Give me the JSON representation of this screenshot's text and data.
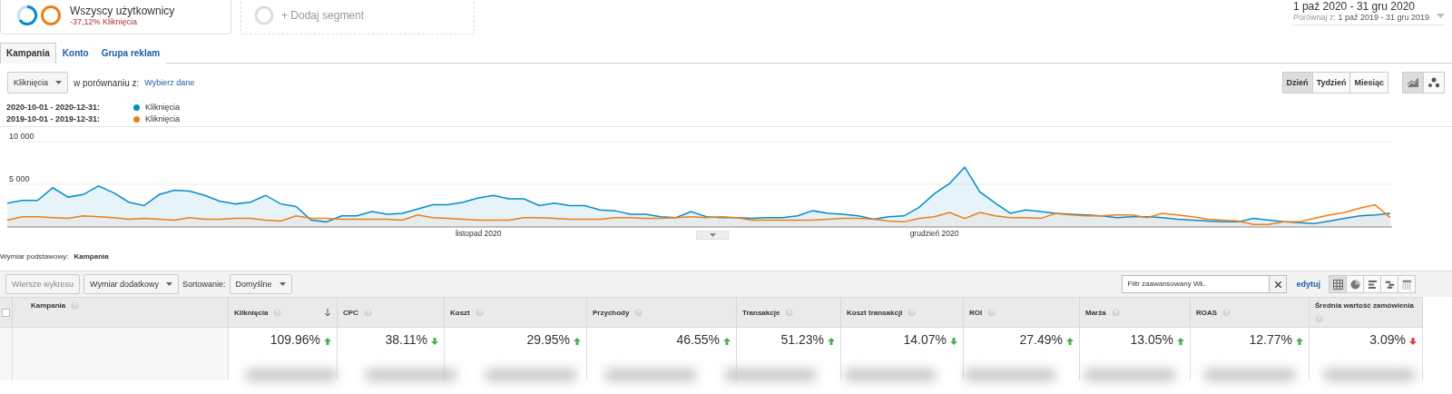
{
  "segments": [
    {
      "name": "Wszyscy użytkownicy",
      "detail": "-37,12% Kliknięcia"
    },
    {
      "name": "+ Dodaj segment",
      "kind": "add"
    }
  ],
  "date_range": {
    "main": "1 paź 2020 - 31 gru 2020",
    "compare_label": "Porównaj z:",
    "compare": "1 paź 2019 - 31 gru 2019"
  },
  "tabs": [
    {
      "label": "Kampania",
      "selected": true
    },
    {
      "label": "Konto",
      "selected": false
    },
    {
      "label": "Grupa reklam",
      "selected": false
    }
  ],
  "metric_select": "Kliknięcia",
  "compare_text": "w porównaniu z:",
  "compare_link": "Wybierz dane",
  "granularity": [
    {
      "label": "Dzień",
      "selected": true
    },
    {
      "label": "Tydzień",
      "selected": false
    },
    {
      "label": "Miesiąc",
      "selected": false
    }
  ],
  "chart_modes": [
    {
      "kind": "line",
      "selected": true
    },
    {
      "kind": "motion",
      "selected": false
    }
  ],
  "legend": [
    {
      "range": "2020-10-01 - 2020-12-31:"
    },
    {
      "range": "2019-10-01 - 2019-12-31:"
    }
  ],
  "chart_data": {
    "type": "area",
    "ylim": [
      0,
      10000
    ],
    "yticks": [
      {
        "value": 5000,
        "label": "5 000"
      },
      {
        "value": 10000,
        "label": "10 000"
      }
    ],
    "series": [
      {
        "name": "Kliknięcia",
        "color": "#058dc7",
        "values": [
          2800,
          3100,
          3100,
          4600,
          3500,
          3800,
          4800,
          4000,
          2900,
          2500,
          3800,
          4300,
          4200,
          3700,
          3000,
          2700,
          2900,
          3700,
          2700,
          2400,
          800,
          600,
          1300,
          1300,
          1800,
          1500,
          1600,
          2100,
          2600,
          2600,
          2900,
          3400,
          3700,
          3300,
          3300,
          2500,
          2800,
          2500,
          2500,
          2000,
          1900,
          1500,
          1500,
          1200,
          1100,
          1800,
          1200,
          1100,
          1100,
          1000,
          1100,
          1100,
          1300,
          1900,
          1600,
          1500,
          1300,
          900,
          1200,
          1300,
          2300,
          3900,
          5100,
          7000,
          4100,
          2800,
          1600,
          2000,
          1800,
          1600,
          1500,
          1400,
          1300,
          1100,
          1200,
          1200,
          1100,
          900,
          800,
          700,
          600,
          600,
          1000,
          800,
          600,
          500,
          400,
          700,
          1000,
          1300,
          1400,
          1600
        ]
      },
      {
        "name": "Kliknięcia",
        "color": "#ed7e17",
        "values": [
          800,
          1200,
          1200,
          1100,
          1000,
          1300,
          1200,
          1100,
          900,
          1000,
          900,
          800,
          1100,
          900,
          900,
          1000,
          1000,
          800,
          700,
          1300,
          1000,
          1000,
          900,
          900,
          900,
          900,
          800,
          1400,
          1100,
          1000,
          900,
          800,
          800,
          800,
          1100,
          1100,
          1000,
          900,
          900,
          900,
          1100,
          1100,
          1000,
          1000,
          1100,
          1200,
          1100,
          1200,
          1100,
          800,
          800,
          800,
          800,
          800,
          900,
          1000,
          1000,
          900,
          700,
          600,
          1000,
          1200,
          1700,
          1000,
          1700,
          1300,
          1100,
          1100,
          1000,
          1600,
          1400,
          1300,
          1300,
          1400,
          1400,
          1100,
          1600,
          1400,
          1200,
          900,
          800,
          700,
          300,
          300,
          600,
          600,
          1000,
          1400,
          1700,
          2200,
          2600,
          1100
        ]
      }
    ]
  },
  "x_labels": [
    "listopad 2020",
    "grudzień 2020"
  ],
  "primary_dimension": {
    "label": "Wymiar podstawowy:",
    "value": "Kampania"
  },
  "table_toolbar": {
    "plot_rows": "Wiersze wykresu",
    "secondary": "Wymiar dodatkowy",
    "sort_label": "Sortowanie:",
    "sort": "Domyślne",
    "filter": "Filtr zaawansowany WŁ.",
    "edit": "edytuj"
  },
  "view_modes": [
    {
      "kind": "table",
      "selected": true
    },
    {
      "kind": "pie",
      "selected": false
    },
    {
      "kind": "bars",
      "selected": false
    },
    {
      "kind": "compare",
      "selected": false
    },
    {
      "kind": "pivot",
      "selected": false
    }
  ],
  "table": {
    "select_all": {
      "checked": false
    },
    "columns": [
      {
        "label": "Kampania"
      },
      {
        "label": "Kliknięcia",
        "sorted": true
      },
      {
        "label": "CPC"
      },
      {
        "label": "Koszt"
      },
      {
        "label": "Przychody"
      },
      {
        "label": "Transakcje"
      },
      {
        "label": "Koszt transakcji"
      },
      {
        "label": "ROI"
      },
      {
        "label": "Marża"
      },
      {
        "label": "ROAS"
      },
      {
        "label": "Średnia wartość zamówienia"
      }
    ],
    "summary": [
      {
        "value": "109.96%",
        "rising": true,
        "good": true
      },
      {
        "value": "38.11%",
        "rising": false,
        "good": true
      },
      {
        "value": "29.95%",
        "rising": true,
        "good": true
      },
      {
        "value": "46.55%",
        "rising": true,
        "good": true
      },
      {
        "value": "51.23%",
        "rising": true,
        "good": true
      },
      {
        "value": "14.07%",
        "rising": false,
        "good": true
      },
      {
        "value": "27.49%",
        "rising": true,
        "good": true
      },
      {
        "value": "13.05%",
        "rising": true,
        "good": true
      },
      {
        "value": "12.77%",
        "rising": true,
        "good": true
      },
      {
        "value": "3.09%",
        "rising": false,
        "good": false
      }
    ]
  }
}
